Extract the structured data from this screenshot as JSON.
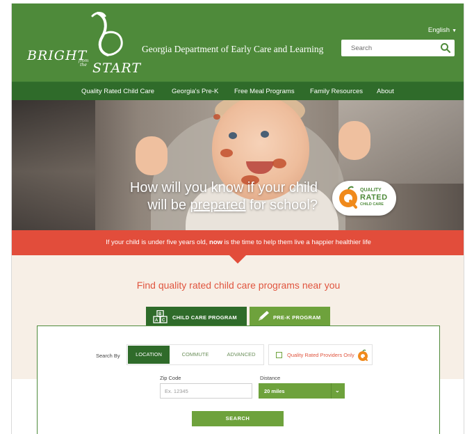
{
  "header": {
    "logo": {
      "bright": "BRIGHT",
      "from_the": "from the",
      "start": "START"
    },
    "department": "Georgia Department of Early Care and Learning",
    "language": "English",
    "search_placeholder": "Search"
  },
  "nav": {
    "items": [
      {
        "label": "Quality Rated Child Care"
      },
      {
        "label": "Georgia's Pre-K"
      },
      {
        "label": "Free Meal Programs"
      },
      {
        "label": "Family Resources"
      },
      {
        "label": "About"
      }
    ]
  },
  "hero": {
    "line1": "How will you know if your child",
    "line2_pre": "will be ",
    "line2_underlined": "prepared",
    "line2_post": " for school?",
    "badge": {
      "top": "QUALITY",
      "main": "RATED",
      "sub": "CHILD CARE"
    }
  },
  "banner": {
    "pre": "If your child is under five years old, ",
    "bold": "now",
    "post": " is the time to help them live a happier healthier life"
  },
  "finder": {
    "title": "Find quality rated child care programs near you",
    "tabs": [
      {
        "label": "CHILD CARE PROGRAM",
        "active": true
      },
      {
        "label": "PRE-K PROGRAM",
        "active": false
      }
    ],
    "search_by_label": "Search By",
    "modes": [
      "LOCATION",
      "COMMUTE",
      "ADVANCED"
    ],
    "active_mode": "LOCATION",
    "quality_only_label": "Quality Rated Providers Only",
    "zip_label": "Zip Code",
    "zip_placeholder": "Ex. 12345",
    "distance_label": "Distance",
    "distance_value": "20 miles",
    "search_button": "SEARCH"
  },
  "colors": {
    "brand_green": "#4e8a3a",
    "dark_green": "#2f6b2a",
    "light_green": "#6ea23c",
    "accent_red": "#e24d3b",
    "title_red": "#e0553f",
    "cream": "#f7efe6"
  },
  "icons": {
    "search": "magnifier-icon",
    "language_caret": "caret-down-icon",
    "child_care_tab": "blocks-icon",
    "prek_tab": "pencil-icon",
    "quality_badge": "quality-rated-q-icon",
    "distance_chevron": "chevron-down-icon"
  }
}
